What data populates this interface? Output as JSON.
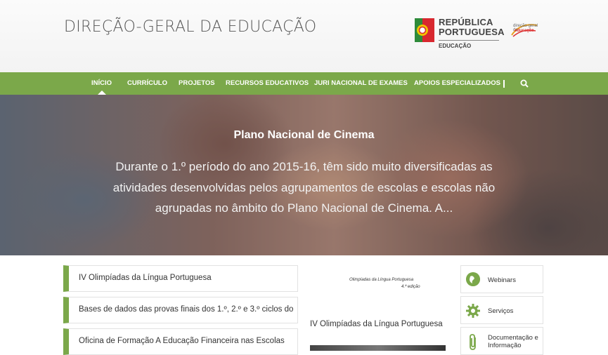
{
  "header": {
    "site_title": "DIREÇÃO-GERAL DA EDUCAÇÃO",
    "rp_logo": {
      "line1": "REPÚBLICA",
      "line2": "PORTUGUESA",
      "line3": "EDUCAÇÃO"
    },
    "dge_logo": {
      "line1": "direção-geral da",
      "line2": "educação"
    }
  },
  "nav": {
    "items": [
      {
        "label": "INÍCIO",
        "active": true
      },
      {
        "label": "CURRÍCULO"
      },
      {
        "label": "PROJETOS"
      },
      {
        "label": "RECURSOS EDUCATIVOS"
      },
      {
        "label": "JURI NACIONAL DE EXAMES"
      },
      {
        "label": "APOIOS ESPECIALIZADOS"
      }
    ],
    "search_icon": "search-icon",
    "accent_color": "#7ba84a"
  },
  "hero": {
    "title": "Plano Nacional de Cinema",
    "text": "Durante o 1.º período do ano 2015-16, têm sido muito diversificadas as atividades desenvolvidas pelos agrupamentos de escolas e escolas não agrupadas no âmbito do Plano Nacional de Cinema. A..."
  },
  "news_list": [
    {
      "title": "IV Olimpíadas da Língua Portuguesa"
    },
    {
      "title": "Bases de dados das provas finais dos 1.º, 2.º e 3.º ciclos do"
    },
    {
      "title": "Oficina de Formação A Educação Financeira nas Escolas"
    }
  ],
  "feature": {
    "image_caption_line1": "Olimpíadas da Língua Portuguesa",
    "image_caption_line2": "4.ª edição",
    "title": "IV Olimpíadas da Língua Portuguesa"
  },
  "sidebar": {
    "items": [
      {
        "label": "Webinars",
        "icon": "globe-icon"
      },
      {
        "label": "Serviços",
        "icon": "gear-icon"
      },
      {
        "label": "Documentação e Informação",
        "icon": "paperclip-icon"
      }
    ]
  }
}
